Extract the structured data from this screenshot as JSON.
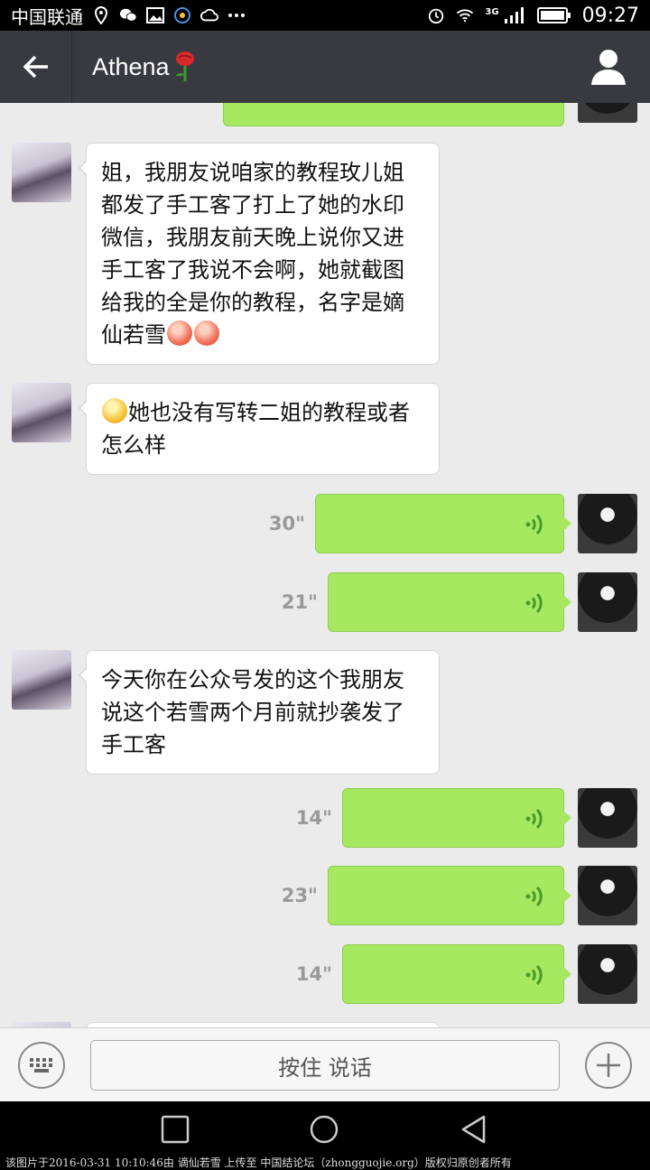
{
  "status_bar": {
    "carrier": "中国联通",
    "network": "3G",
    "time": "09:27",
    "icons": [
      "location-icon",
      "wechat-icon",
      "image-icon",
      "notify-icon",
      "cloud-icon",
      "more-dots-icon",
      "alarm-icon",
      "wifi-icon",
      "signal-icon",
      "battery-icon"
    ]
  },
  "header": {
    "title": "Athena",
    "title_emoji": "rose-icon",
    "back_icon": "back-arrow-icon",
    "profile_icon": "person-icon"
  },
  "messages": [
    {
      "type": "text",
      "side": "left",
      "text": "姐，我朋友说咱家的教程玫儿姐都发了手工客了打上了她的水印微信，我朋友前天晚上说你又进手工客了我说不会啊，她就截图给我的全是你的教程，名字是嫡仙若雪",
      "trailing_emojis": [
        "blush-emoji",
        "blush-emoji"
      ]
    },
    {
      "type": "text",
      "side": "left",
      "leading_emoji": "hush-emoji",
      "text": "她也没有写转二姐的教程或者怎么样"
    },
    {
      "type": "voice",
      "side": "right",
      "duration": "30\""
    },
    {
      "type": "voice",
      "side": "right",
      "duration": "21\""
    },
    {
      "type": "text",
      "side": "left",
      "text": "今天你在公众号发的这个我朋友说这个若雪两个月前就抄袭发了手工客"
    },
    {
      "type": "voice",
      "side": "right",
      "duration": "14\""
    },
    {
      "type": "voice",
      "side": "right",
      "duration": "23\""
    },
    {
      "type": "voice",
      "side": "right",
      "duration": "14\""
    }
  ],
  "input_bar": {
    "keyboard_icon": "keyboard-icon",
    "hold_to_talk_label": "按住 说话",
    "plus_icon": "plus-icon"
  },
  "nav_bar": {
    "icons": [
      "recents-square-icon",
      "home-circle-icon",
      "back-triangle-icon"
    ]
  },
  "caption": "该图片于2016-03-31 10:10:46由 谪仙若雪 上传至 中国结论坛（zhongguojie.org）版权归原创者所有",
  "colors": {
    "header_bg": "#393a3f",
    "chat_bg": "#ebebeb",
    "voice_bubble": "#a6e860",
    "text_bubble": "#ffffff"
  }
}
